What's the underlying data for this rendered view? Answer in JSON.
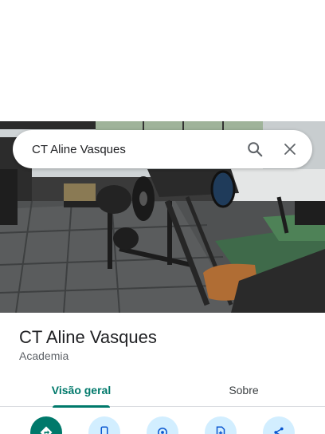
{
  "search": {
    "query": "CT Aline Vasques"
  },
  "place": {
    "name": "CT Aline Vasques",
    "category": "Academia"
  },
  "tabs": [
    {
      "label": "Visão geral",
      "active": true
    },
    {
      "label": "Sobre",
      "active": false
    }
  ],
  "actions": [
    {
      "icon": "directions-icon"
    },
    {
      "icon": "phone-icon"
    },
    {
      "icon": "location-icon"
    },
    {
      "icon": "save-icon"
    },
    {
      "icon": "share-icon"
    }
  ],
  "colors": {
    "accent": "#00796b",
    "action_bg": "#d2eeff",
    "text": "#202124",
    "subtext": "#5f6368"
  }
}
